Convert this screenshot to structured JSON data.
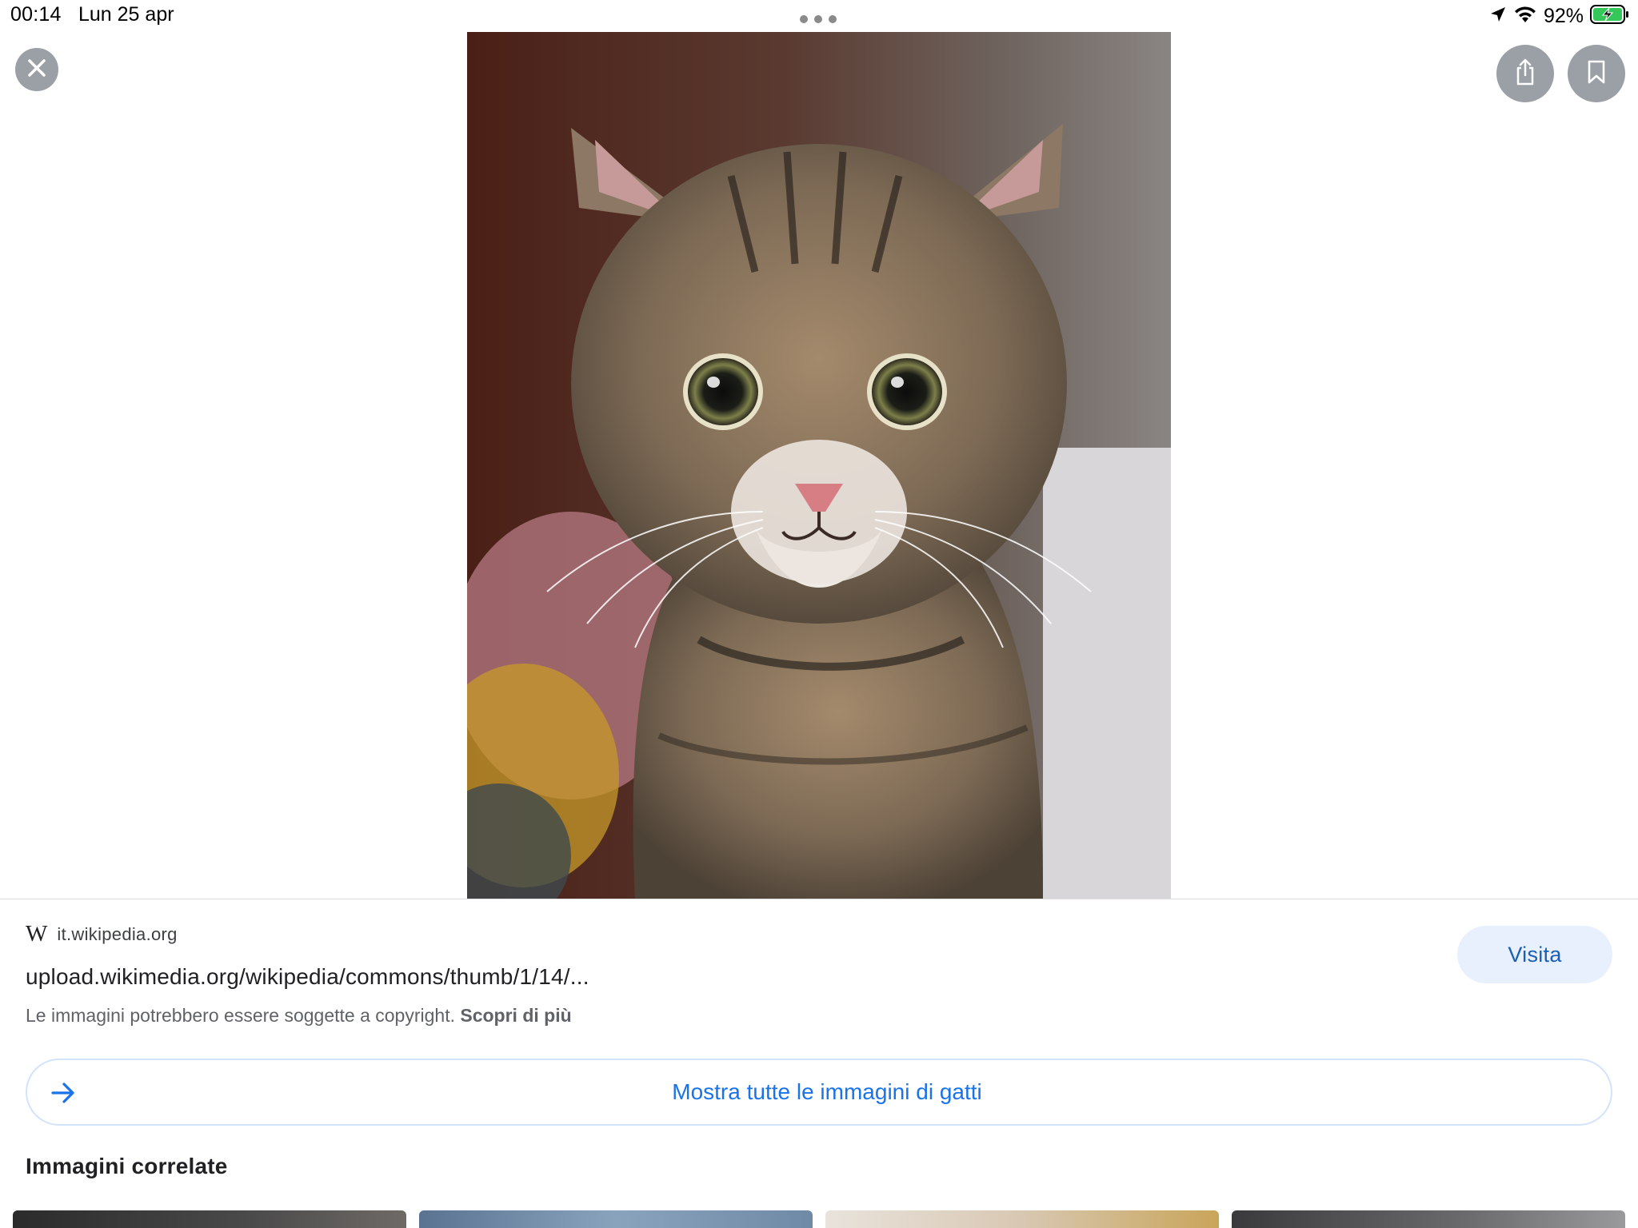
{
  "status_bar": {
    "time": "00:14",
    "date": "Lun 25 apr",
    "battery_percent": "92%",
    "icons": [
      "location-arrow-icon",
      "wifi-icon",
      "battery-charging-icon"
    ]
  },
  "controls": {
    "close_icon": "close-icon",
    "share_icon": "share-icon",
    "bookmark_icon": "bookmark-icon"
  },
  "hero_image": {
    "subject": "tabby-kitten-photo"
  },
  "result": {
    "source_logo": "W",
    "source_domain": "it.wikipedia.org",
    "url": "upload.wikimedia.org/wikipedia/commons/thumb/1/14/...",
    "copyright_notice": "Le immagini potrebbero essere soggette a copyright.",
    "learn_more": "Scopri di più",
    "visit_label": "Visita"
  },
  "show_all": {
    "label": "Mostra tutte le immagini di gatti",
    "icon": "arrow-right-icon"
  },
  "related": {
    "title": "Immagini correlate",
    "thumbnails": [
      "related-thumb-1",
      "related-thumb-2",
      "related-thumb-3",
      "related-thumb-4"
    ]
  },
  "colors": {
    "accent": "#1a73e8",
    "visit_bg": "#e8f0fe",
    "button_gray": "#9aa0a6",
    "battery_green": "#34c759"
  }
}
